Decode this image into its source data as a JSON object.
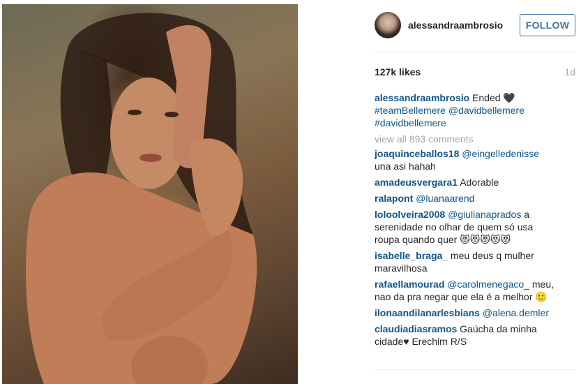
{
  "post": {
    "image_alt": "Photo of a woman with long dark hair posing on rocks at sunset"
  },
  "header": {
    "username": "alessandraambrosio",
    "follow_label": "FOLLOW"
  },
  "stats": {
    "likes": "127k likes",
    "age": "1d"
  },
  "caption": {
    "user": "alessandraambrosio",
    "text": " Ended 🖤",
    "tags": [
      "#teamBellemere",
      "@davidbellemere",
      "#davidbellemere"
    ]
  },
  "view_all": "view all 893 comments",
  "comments": [
    {
      "user": "joaquinceballos18",
      "mention": "@eingelledenisse",
      "text": " una asi hahah"
    },
    {
      "user": "amadeusvergara1",
      "mention": "",
      "text": " Adorable"
    },
    {
      "user": "ralapont",
      "mention": "@luanaarend",
      "text": ""
    },
    {
      "user": "loloolveira2008",
      "mention": "@giulianaprados",
      "text": " a serenidade no olhar de quem só usa roupa quando quer 😻😻😻😻😻"
    },
    {
      "user": "isabelle_braga_",
      "mention": "",
      "text": " meu deus q mulher maravilhosa"
    },
    {
      "user": "rafaellamourad",
      "mention": "@carolmenegaco_",
      "text": " meu, nao da pra negar que ela é a melhor 🙂"
    },
    {
      "user": "ilonaandilanarlesbians",
      "mention": "@alena.demler",
      "text": ""
    },
    {
      "user": "claudiadiasramos",
      "mention": "",
      "text": " Gaúcha da minha cidade♥ Erechim R/S"
    }
  ],
  "colors": {
    "link": "#125688",
    "follow": "#3f729b",
    "muted": "#a5a7aa"
  }
}
